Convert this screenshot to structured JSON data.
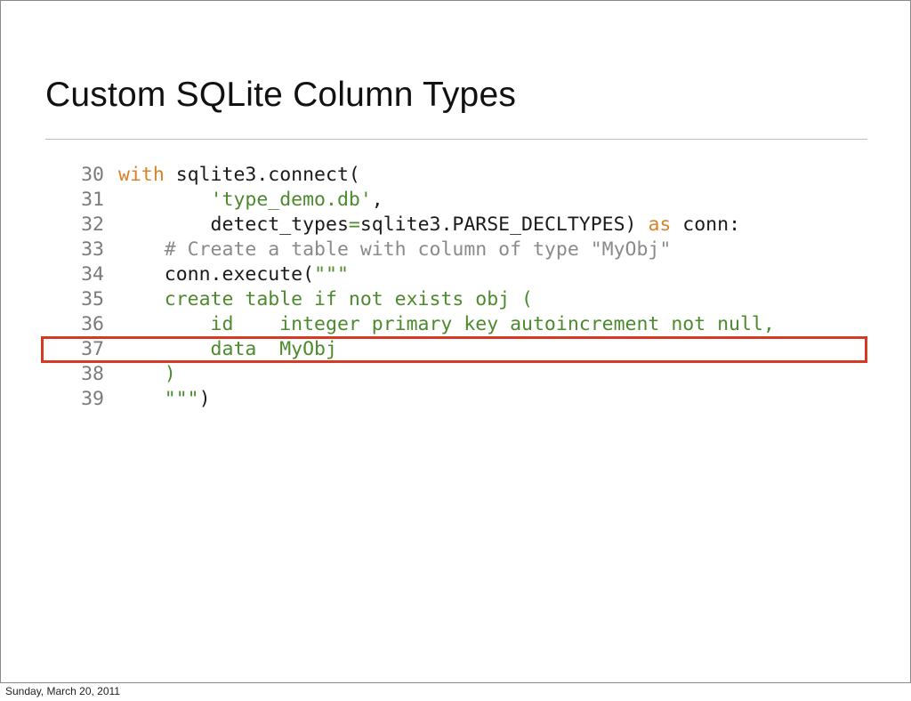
{
  "slide": {
    "title": "Custom SQLite Column Types",
    "footer_date": "Sunday, March 20, 2011",
    "highlight_color": "#d63a22"
  },
  "code": {
    "lines": [
      {
        "num": "30",
        "parts": [
          {
            "t": "kw",
            "text": "with"
          },
          {
            "t": "plain",
            "text": " sqlite3.connect("
          }
        ]
      },
      {
        "num": "31",
        "parts": [
          {
            "t": "plain",
            "text": "        "
          },
          {
            "t": "str",
            "text": "'type_demo.db'"
          },
          {
            "t": "plain",
            "text": ","
          }
        ]
      },
      {
        "num": "32",
        "parts": [
          {
            "t": "plain",
            "text": "        detect_types"
          },
          {
            "t": "op",
            "text": "="
          },
          {
            "t": "plain",
            "text": "sqlite3.PARSE_DECLTYPES) "
          },
          {
            "t": "kw",
            "text": "as"
          },
          {
            "t": "plain",
            "text": " conn:"
          }
        ]
      },
      {
        "num": "33",
        "parts": [
          {
            "t": "plain",
            "text": "    "
          },
          {
            "t": "cmt",
            "text": "# Create a table with column of type \"MyObj\""
          }
        ]
      },
      {
        "num": "34",
        "parts": [
          {
            "t": "plain",
            "text": "    conn.execute("
          },
          {
            "t": "str",
            "text": "\"\"\""
          }
        ]
      },
      {
        "num": "35",
        "parts": [
          {
            "t": "str",
            "text": "    create table if not exists obj ("
          }
        ]
      },
      {
        "num": "36",
        "parts": [
          {
            "t": "str",
            "text": "        id    integer primary key autoincrement not null,"
          }
        ]
      },
      {
        "num": "37",
        "parts": [
          {
            "t": "str",
            "text": "        data  MyObj"
          }
        ]
      },
      {
        "num": "38",
        "parts": [
          {
            "t": "str",
            "text": "    )"
          }
        ]
      },
      {
        "num": "39",
        "parts": [
          {
            "t": "str",
            "text": "    \"\"\""
          },
          {
            "t": "plain",
            "text": ")"
          }
        ]
      }
    ]
  }
}
